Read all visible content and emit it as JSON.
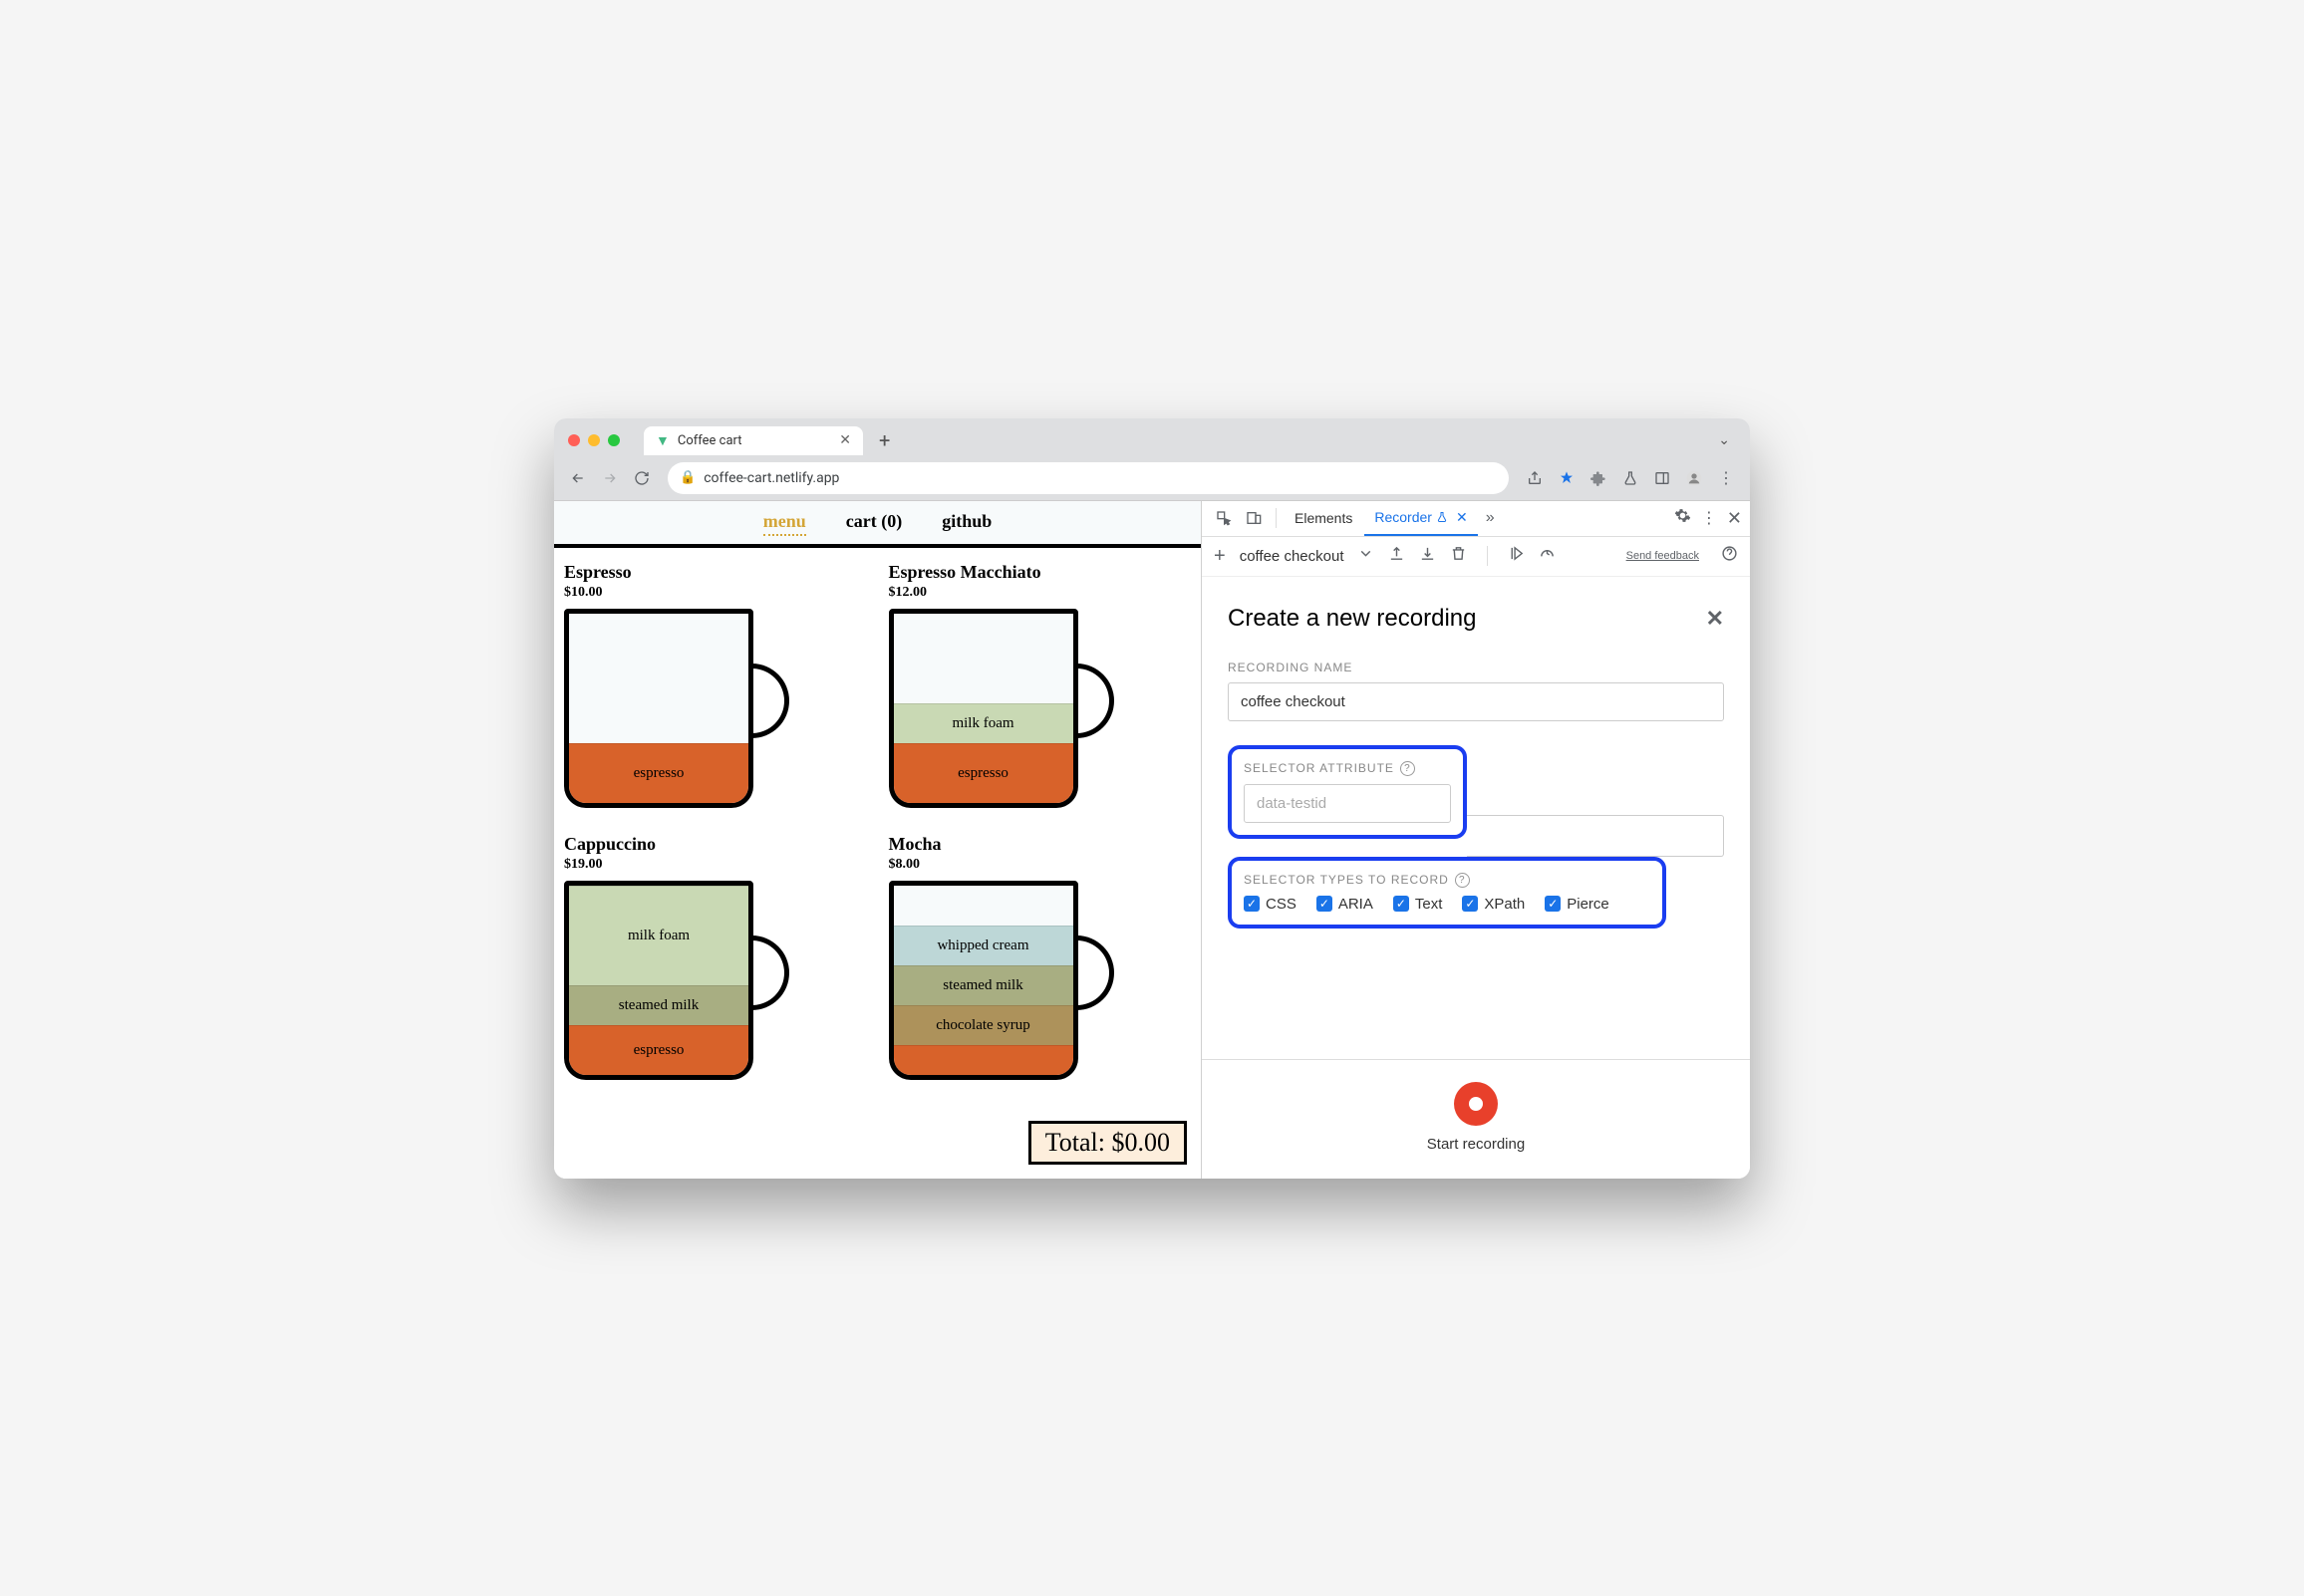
{
  "browser": {
    "tab_title": "Coffee cart",
    "url": "coffee-cart.netlify.app"
  },
  "page": {
    "nav": {
      "menu": "menu",
      "cart": "cart (0)",
      "github": "github"
    },
    "items": {
      "espresso": {
        "name": "Espresso",
        "price": "$10.00",
        "layer_espresso": "espresso"
      },
      "macchiato": {
        "name": "Espresso Macchiato",
        "price": "$12.00",
        "layer_milkfoam": "milk foam",
        "layer_espresso": "espresso"
      },
      "cappuccino": {
        "name": "Cappuccino",
        "price": "$19.00",
        "layer_milkfoam": "milk foam",
        "layer_steamed": "steamed milk",
        "layer_espresso": "espresso"
      },
      "mocha": {
        "name": "Mocha",
        "price": "$8.00",
        "layer_whip": "whipped cream",
        "layer_steamed": "steamed milk",
        "layer_choc": "chocolate syrup"
      }
    },
    "total_label": "Total: $0.00"
  },
  "devtools": {
    "tabs": {
      "elements": "Elements",
      "recorder": "Recorder"
    },
    "recording_dropdown": "coffee checkout",
    "feedback": "Send feedback",
    "panel": {
      "title": "Create a new recording",
      "recording_name_label": "RECORDING NAME",
      "recording_name_value": "coffee checkout",
      "selector_attr_label": "SELECTOR ATTRIBUTE",
      "selector_attr_placeholder": "data-testid",
      "selector_types_label": "SELECTOR TYPES TO RECORD",
      "types": {
        "css": "CSS",
        "aria": "ARIA",
        "text": "Text",
        "xpath": "XPath",
        "pierce": "Pierce"
      },
      "start_label": "Start recording"
    }
  }
}
